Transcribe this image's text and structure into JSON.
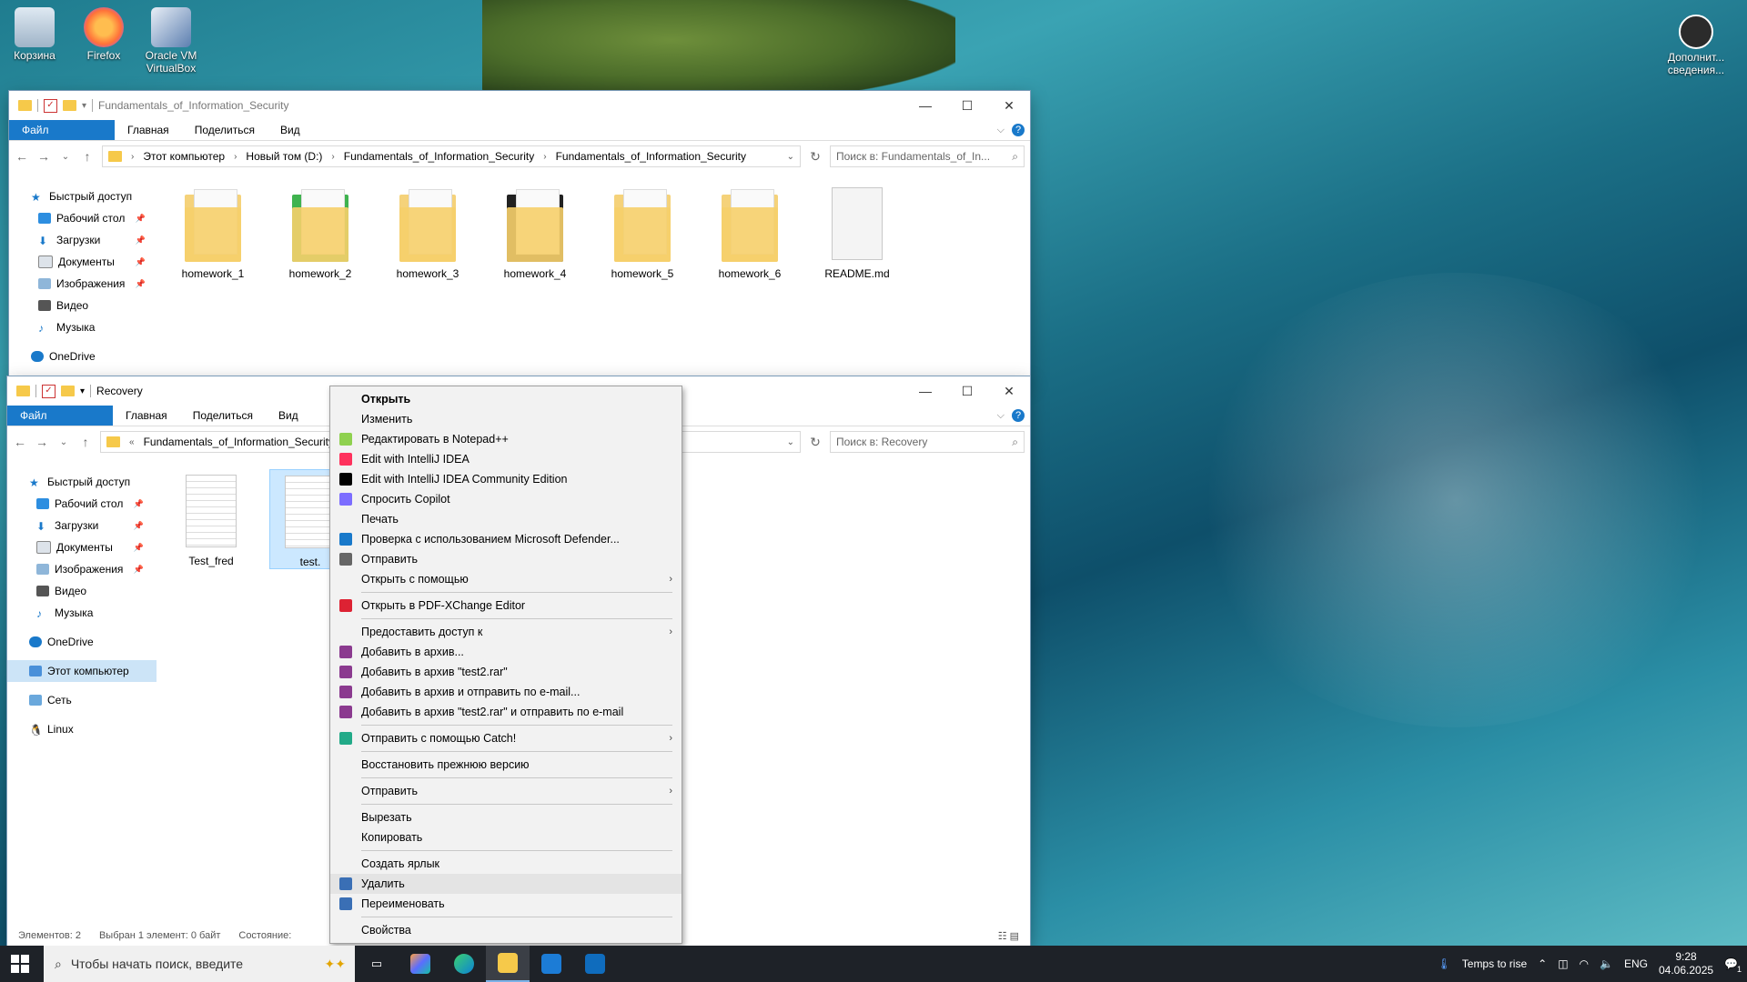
{
  "desktop": {
    "icons": [
      {
        "label": "Корзина"
      },
      {
        "label": "Firefox"
      },
      {
        "label": "Oracle VM VirtualBox"
      }
    ],
    "corner_label": "Дополнит... сведения..."
  },
  "window1": {
    "title": "Fundamentals_of_Information_Security",
    "ribbon": {
      "file": "Файл",
      "home": "Главная",
      "share": "Поделиться",
      "view": "Вид"
    },
    "address": [
      "Этот компьютер",
      "Новый том (D:)",
      "Fundamentals_of_Information_Security",
      "Fundamentals_of_Information_Security"
    ],
    "search_placeholder": "Поиск в: Fundamentals_of_In...",
    "nav": [
      {
        "label": "Быстрый доступ"
      },
      {
        "label": "Рабочий стол"
      },
      {
        "label": "Загрузки"
      },
      {
        "label": "Документы"
      },
      {
        "label": "Изображения"
      },
      {
        "label": "Видео"
      },
      {
        "label": "Музыка"
      },
      {
        "label": "OneDrive"
      }
    ],
    "files": [
      {
        "name": "homework_1"
      },
      {
        "name": "homework_2"
      },
      {
        "name": "homework_3"
      },
      {
        "name": "homework_4"
      },
      {
        "name": "homework_5"
      },
      {
        "name": "homework_6"
      },
      {
        "name": "README.md"
      }
    ]
  },
  "window2": {
    "title": "Recovery",
    "ribbon": {
      "file": "Файл",
      "home": "Главная",
      "share": "Поделиться",
      "view": "Вид"
    },
    "address": "Fundamentals_of_Information_Security",
    "address_prefix": "«",
    "search_placeholder": "Поиск в: Recovery",
    "nav": [
      {
        "label": "Быстрый доступ"
      },
      {
        "label": "Рабочий стол"
      },
      {
        "label": "Загрузки"
      },
      {
        "label": "Документы"
      },
      {
        "label": "Изображения"
      },
      {
        "label": "Видео"
      },
      {
        "label": "Музыка"
      },
      {
        "label": "OneDrive"
      },
      {
        "label": "Этот компьютер"
      },
      {
        "label": "Сеть"
      },
      {
        "label": "Linux"
      }
    ],
    "files": [
      {
        "name": "Test_fred"
      },
      {
        "name": "test."
      }
    ],
    "status": {
      "count": "Элементов: 2",
      "selected": "Выбран 1 элемент: 0 байт",
      "state": "Состояние:"
    }
  },
  "context_menu": {
    "items": [
      {
        "label": "Открыть",
        "bold": true
      },
      {
        "label": "Изменить"
      },
      {
        "label": "Редактировать в Notepad++",
        "icon": "notepadpp-icon"
      },
      {
        "label": "Edit with IntelliJ IDEA",
        "icon": "intellij-icon"
      },
      {
        "label": "Edit with IntelliJ IDEA Community Edition",
        "icon": "intellij-ce-icon"
      },
      {
        "label": "Спросить Copilot",
        "icon": "copilot-icon"
      },
      {
        "label": "Печать"
      },
      {
        "label": "Проверка с использованием Microsoft Defender...",
        "icon": "defender-icon"
      },
      {
        "label": "Отправить",
        "icon": "share-icon"
      },
      {
        "label": "Открыть с помощью",
        "submenu": true
      },
      {
        "sep": true
      },
      {
        "label": "Открыть в PDF-XChange Editor",
        "icon": "pdfxchange-icon"
      },
      {
        "sep": true
      },
      {
        "label": "Предоставить доступ к",
        "submenu": true
      },
      {
        "label": "Добавить в архив...",
        "icon": "winrar-icon"
      },
      {
        "label": "Добавить в архив \"test2.rar\"",
        "icon": "winrar-icon"
      },
      {
        "label": "Добавить в архив и отправить по e-mail...",
        "icon": "winrar-icon"
      },
      {
        "label": "Добавить в архив \"test2.rar\" и отправить по e-mail",
        "icon": "winrar-icon"
      },
      {
        "sep": true
      },
      {
        "label": "Отправить с помощью Catch!",
        "icon": "catch-icon",
        "submenu": true
      },
      {
        "sep": true
      },
      {
        "label": "Восстановить прежнюю версию"
      },
      {
        "sep": true
      },
      {
        "label": "Отправить",
        "submenu": true
      },
      {
        "sep": true
      },
      {
        "label": "Вырезать"
      },
      {
        "label": "Копировать"
      },
      {
        "sep": true
      },
      {
        "label": "Создать ярлык"
      },
      {
        "label": "Удалить",
        "icon": "shield-icon",
        "highlight": true
      },
      {
        "label": "Переименовать",
        "icon": "shield-icon"
      },
      {
        "sep": true
      },
      {
        "label": "Свойства"
      }
    ]
  },
  "taskbar": {
    "search_placeholder": "Чтобы начать поиск, введите",
    "weather": "Temps to rise",
    "lang": "ENG",
    "time": "9:28",
    "date": "04.06.2025",
    "notif_count": "1"
  },
  "colors": {
    "accent": "#1979ca",
    "folder": "#f5d27a",
    "taskbar": "#1e2228"
  }
}
